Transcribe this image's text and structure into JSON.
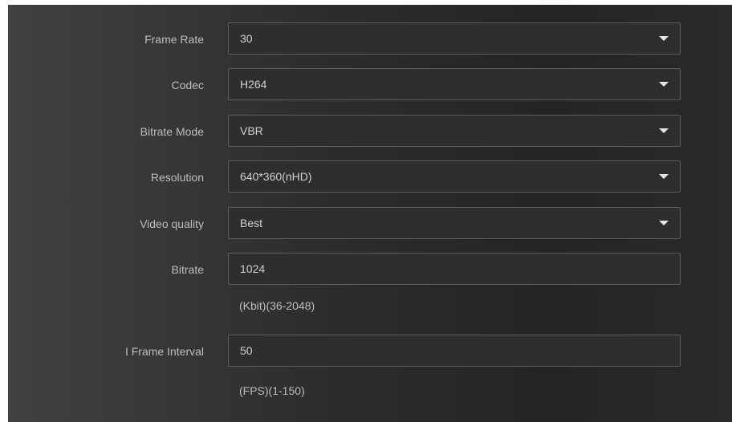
{
  "form": {
    "frame_rate": {
      "label": "Frame Rate",
      "value": "30"
    },
    "codec": {
      "label": "Codec",
      "value": "H264"
    },
    "bitrate_mode": {
      "label": "Bitrate Mode",
      "value": "VBR"
    },
    "resolution": {
      "label": "Resolution",
      "value": "640*360(nHD)"
    },
    "video_quality": {
      "label": "Video quality",
      "value": "Best"
    },
    "bitrate": {
      "label": "Bitrate",
      "value": "1024",
      "hint": "(Kbit)(36-2048)"
    },
    "i_frame_interval": {
      "label": "I Frame Interval",
      "value": "50",
      "hint": "(FPS)(1-150)"
    }
  },
  "icons": {
    "dropdown": "caret-down-icon"
  }
}
